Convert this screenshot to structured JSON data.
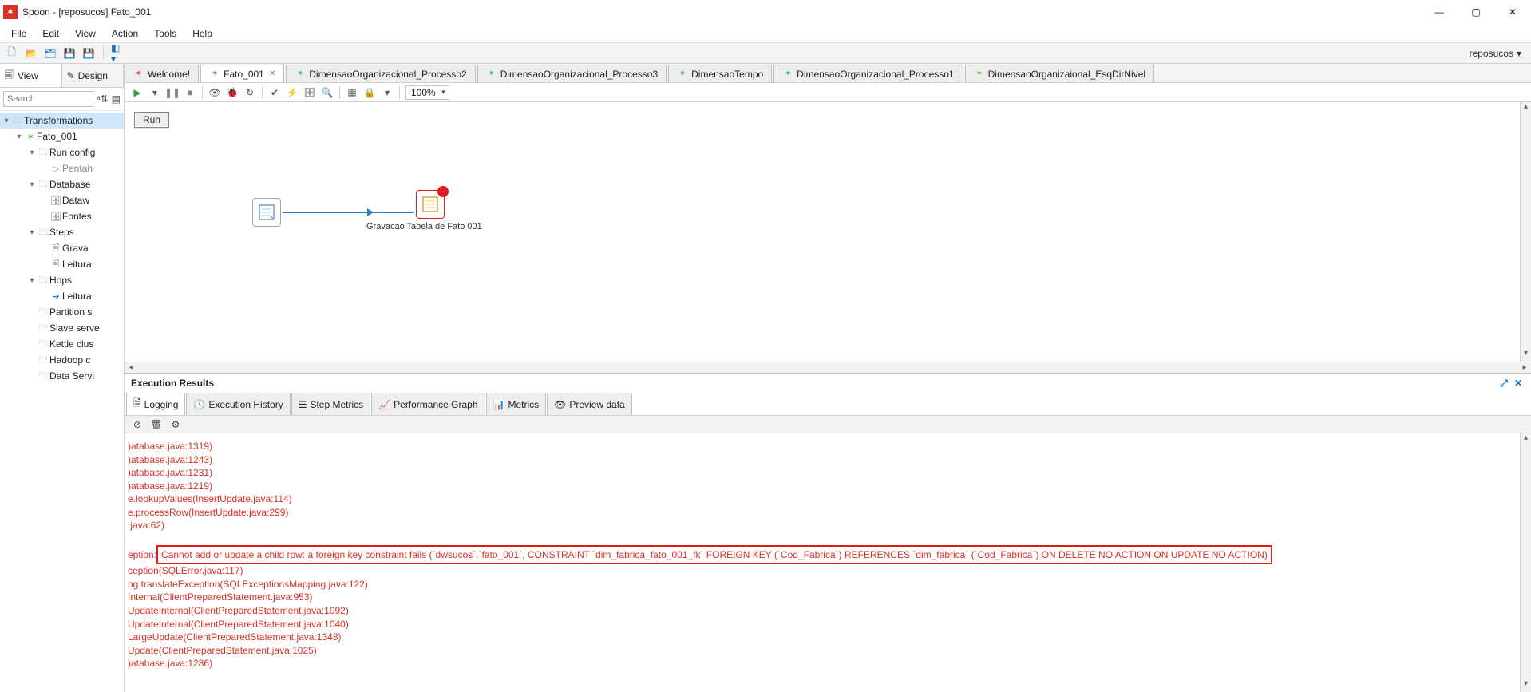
{
  "window": {
    "title": "Spoon - [reposucos] Fato_001"
  },
  "menu": {
    "file": "File",
    "edit": "Edit",
    "view": "View",
    "action": "Action",
    "tools": "Tools",
    "help": "Help"
  },
  "repo": {
    "name": "reposucos"
  },
  "side": {
    "view_tab": "View",
    "design_tab": "Design",
    "search_placeholder": "Search",
    "tree": {
      "transformations": "Transformations",
      "fato": "Fato_001",
      "runcfg": "Run config",
      "pentah": "Pentah",
      "database": "Database",
      "dataw": "Dataw",
      "fontes": "Fontes",
      "steps": "Steps",
      "grava": "Grava",
      "leitura_step": "Leitura",
      "hops": "Hops",
      "leitura_hop": "Leitura",
      "partition": "Partition s",
      "slave": "Slave serve",
      "kettle": "Kettle clus",
      "hadoop": "Hadoop c",
      "dataserv": "Data Servi"
    }
  },
  "tabs": {
    "welcome": "Welcome!",
    "fato": "Fato_001",
    "dim_p2": "DimensaoOrganizacional_Processo2",
    "dim_p3": "DimensaoOrganizacional_Processo3",
    "dim_tempo": "DimensaoTempo",
    "dim_p1": "DimensaoOrganizacional_Processo1",
    "dim_esq": "DimensaoOrganizaional_EsqDirNivel"
  },
  "canvas": {
    "run_btn": "Run",
    "zoom": "100%",
    "step2_label": "Gravacao Tabela de Fato 001"
  },
  "exec": {
    "title": "Execution Results",
    "tabs": {
      "logging": "Logging",
      "history": "Execution History",
      "step_metrics": "Step Metrics",
      "perf": "Performance Graph",
      "metrics": "Metrics",
      "preview": "Preview data"
    },
    "log": [
      ")atabase.java:1319)",
      ")atabase.java:1243)",
      ")atabase.java:1231)",
      ")atabase.java:1219)",
      "e.lookupValues(InsertUpdate.java:114)",
      "e.processRow(InsertUpdate.java:299)",
      ".java:62)"
    ],
    "log_hl_pre": "eption:",
    "log_hl": " Cannot add or update a child row: a foreign key constraint fails (`dwsucos`.`fato_001`, CONSTRAINT `dim_fabrica_fato_001_fk` FOREIGN KEY (`Cod_Fabrica`) REFERENCES `dim_fabrica` (`Cod_Fabrica`) ON DELETE NO ACTION ON UPDATE NO ACTION)",
    "log2": [
      "ception(SQLError.java:117)",
      "ng.translateException(SQLExceptionsMapping.java:122)",
      "Internal(ClientPreparedStatement.java:953)",
      "UpdateInternal(ClientPreparedStatement.java:1092)",
      "UpdateInternal(ClientPreparedStatement.java:1040)",
      "LargeUpdate(ClientPreparedStatement.java:1348)",
      "Update(ClientPreparedStatement.java:1025)",
      ")atabase.java:1286)"
    ]
  }
}
